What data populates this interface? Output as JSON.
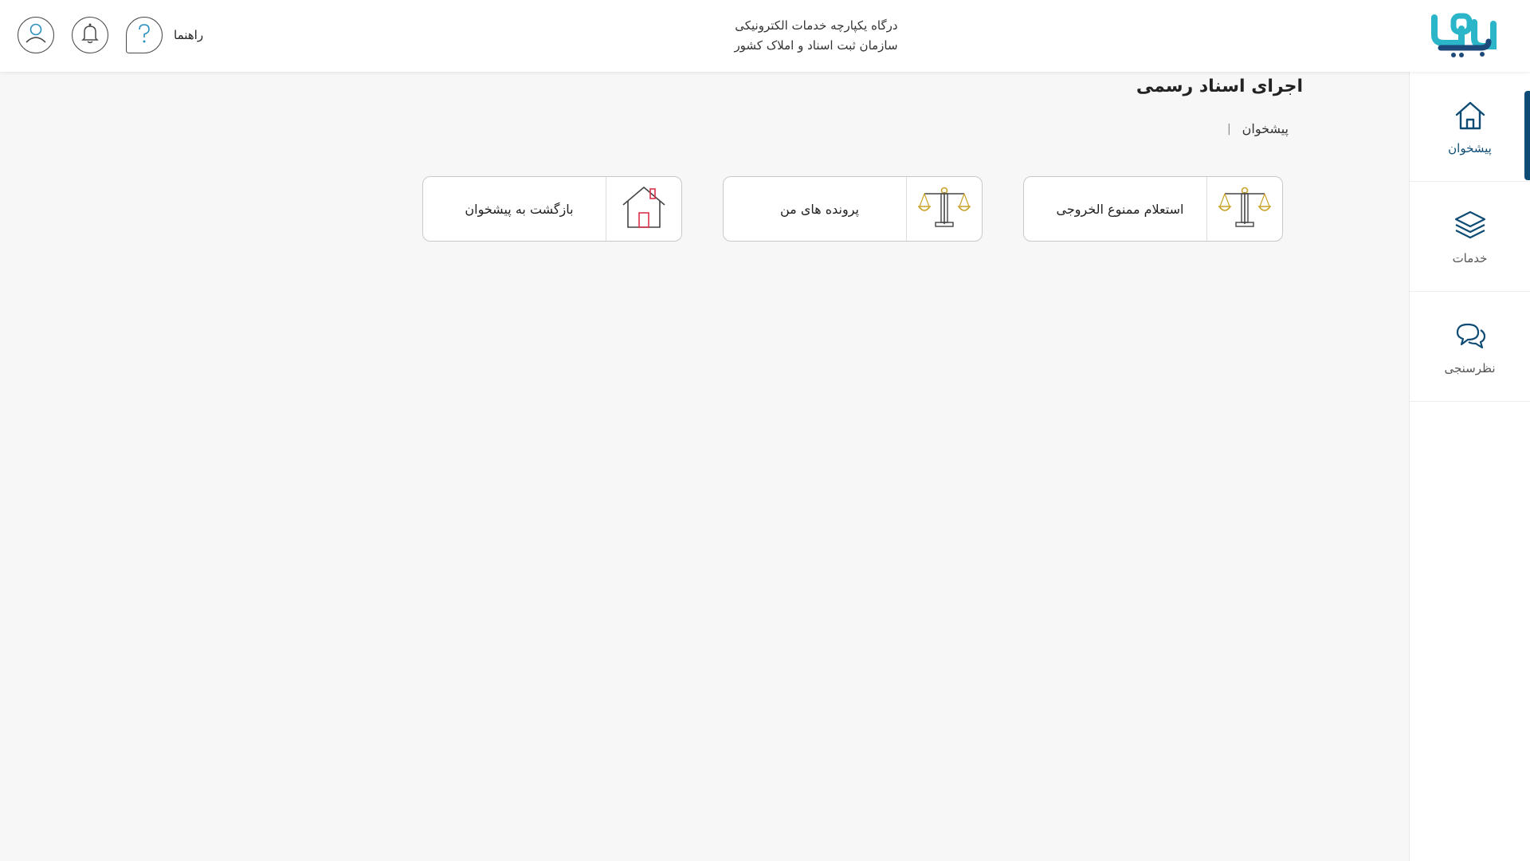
{
  "header": {
    "title_line1": "درگاه یکپارچه خدمات الکترونیکی",
    "title_line2": "سازمان ثبت اسناد و املاک کشور",
    "help_label": "راهنما",
    "icons": [
      "user-icon",
      "bell-icon",
      "help-icon"
    ]
  },
  "sidebar": {
    "items": [
      {
        "label": "پیشخوان",
        "icon": "home-icon",
        "active": true
      },
      {
        "label": "خدمات",
        "icon": "layers-icon",
        "active": false
      },
      {
        "label": "نظرسنجی",
        "icon": "chat-icon",
        "active": false
      }
    ]
  },
  "page": {
    "title": "اجرای اسناد رسمی",
    "breadcrumb": [
      "پیشخوان"
    ]
  },
  "cards": [
    {
      "label": "استعلام ممنوع الخروجی",
      "icon": "scales-icon"
    },
    {
      "label": "پرونده های من",
      "icon": "scales-icon"
    },
    {
      "label": "بازگشت به پیشخوان",
      "icon": "house-icon"
    }
  ],
  "colors": {
    "accent": "#0f4c75",
    "logo_cyan": "#2bb5c9",
    "logo_navy": "#1d4a7a",
    "scales_gold": "#c9a227",
    "house_red": "#d8334a"
  }
}
